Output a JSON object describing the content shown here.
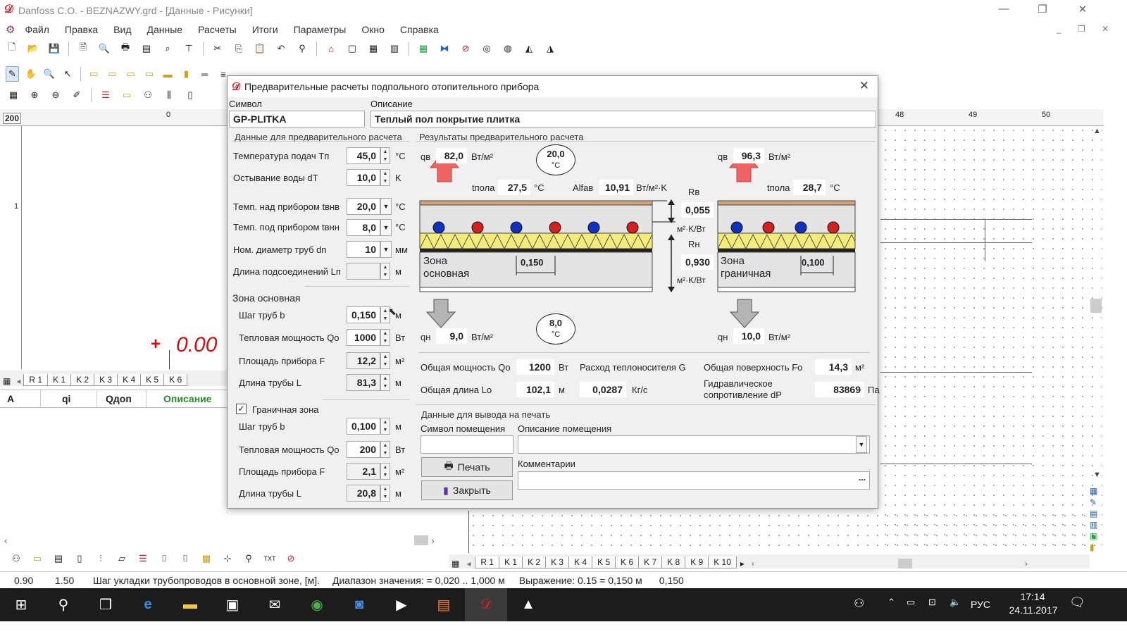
{
  "window": {
    "title": "Danfoss C.O.  - BEZNAZWY.grd - [Данные - Рисунки]"
  },
  "menu": [
    "Файл",
    "Правка",
    "Вид",
    "Данные",
    "Расчеты",
    "Итоги",
    "Параметры",
    "Окно",
    "Справка"
  ],
  "ruler": {
    "scale_label": "200",
    "zero": "0",
    "one": "1",
    "marks": [
      "48",
      "49",
      "50"
    ]
  },
  "left": {
    "elevation": "0.00",
    "plus": "+",
    "tabs": [
      "R 1",
      "K 1",
      "K 2",
      "K 3",
      "K 4",
      "K 5",
      "K 6"
    ],
    "table_headers": [
      "A",
      "qi",
      "Qдоп",
      "Описание"
    ]
  },
  "dialog": {
    "title": "Предварительные расчеты подпольного отопительного прибора",
    "symbol_label": "Символ",
    "symbol_value": "GP-PLITKA",
    "desc_label": "Описание",
    "desc_value": "Теплый пол покрытие плитка",
    "input_section": "Данные для предварительного расчета",
    "inputs": [
      {
        "label": "Температура подач  Tп",
        "value": "45,0",
        "unit": "°С",
        "ctl": "spin"
      },
      {
        "label": "Остывание воды dT",
        "value": "10,0",
        "unit": "K",
        "ctl": "spin"
      },
      {
        "label": "Темп. над прибором tвнв",
        "value": "20,0",
        "unit": "°С",
        "ctl": "dd"
      },
      {
        "label": "Темп. под прибором tвнн",
        "value": "8,0",
        "unit": "°С",
        "ctl": "dd"
      },
      {
        "label": "Ном. диаметр труб dn",
        "value": "10",
        "unit": "мм",
        "ctl": "dd"
      },
      {
        "label": "Длина подсоединений Lп",
        "value": "",
        "unit": "м",
        "ctl": "spin"
      }
    ],
    "zone_main": {
      "title": "Зона основная",
      "rows": [
        {
          "label": "Шаг труб b",
          "value": "0,150",
          "unit": "м"
        },
        {
          "label": "Тепловая мощность Qo",
          "value": "1000",
          "unit": "Вт"
        },
        {
          "label": "Площадь прибора F",
          "value": "12,2",
          "unit": "м²"
        },
        {
          "label": "Длина трубы L",
          "value": "81,3",
          "unit": "м"
        }
      ]
    },
    "zone_edge": {
      "title": "Граничная зона",
      "checked": true,
      "rows": [
        {
          "label": "Шаг труб b",
          "value": "0,100",
          "unit": "м"
        },
        {
          "label": "Тепловая мощность Qo",
          "value": "200",
          "unit": "Вт"
        },
        {
          "label": "Площадь прибора F",
          "value": "2,1",
          "unit": "м²"
        },
        {
          "label": "Длина трубы L",
          "value": "20,8",
          "unit": "м"
        }
      ]
    },
    "results_section": "Результаты предварительного расчета",
    "results": {
      "qv_label": "qв",
      "qv_main": "82,0",
      "qv_edge": "96,3",
      "q_unit": "Вт/м²",
      "tpola_label": "tпола",
      "tpola_main": "27,5",
      "tpola_edge": "28,7",
      "t_unit": "°С",
      "alfa_label": "Alfaв",
      "alfa_value": "10,91",
      "alfa_unit": "Вт/м²·K",
      "t_up": "20,0",
      "t_down": "8,0",
      "deg": "°С",
      "rv_label": "Rв",
      "rv_value": "0,055",
      "rn_label": "Rн",
      "rn_value": "0,930",
      "r_unit": "м²·K/Вт",
      "qn_label": "qн",
      "qn_main": "9,0",
      "qn_edge": "10,0",
      "zone_main_label": "Зона\nосновная",
      "zone_edge_label": "Зона\nграничная",
      "pitch_main": "0,150",
      "pitch_edge": "0,100"
    },
    "totals": {
      "qo_label": "Общая мощность Qo",
      "qo_value": "1200",
      "qo_unit": "Вт",
      "g_label": "Расход теплоносителя G",
      "g_value": "0,0287",
      "g_unit": "Кг/с",
      "fo_label": "Общая поверхность Fo",
      "fo_value": "14,3",
      "fo_unit": "м²",
      "lo_label": "Общая длина Lo",
      "lo_value": "102,1",
      "lo_unit": "м",
      "dp_label": "Гидравлическое\nсопротивление dP",
      "dp_value": "83869",
      "dp_unit": "Па"
    },
    "print": {
      "section": "Данные для вывода на печать",
      "room_symbol_label": "Символ помещения",
      "room_desc_label": "Описание помещения",
      "comments_label": "Комментарии",
      "print_btn": "Печать",
      "close_btn": "Закрыть",
      "ellipsis": "..."
    }
  },
  "bottom_tabs": [
    "R 1",
    "K 1",
    "K 2",
    "K 3",
    "K 4",
    "K 5",
    "K 6",
    "K 7",
    "K 8",
    "K 9",
    "K 10"
  ],
  "status": {
    "a": "0.90",
    "b": "1.50",
    "msg": "Шаг укладки трубопроводов в основной зоне, [м].",
    "range": "Диапазон значения: = 0,020 .. 1,000 м",
    "expr": "Выражение:  0.15 = 0,150 м",
    "val": "0,150"
  },
  "taskbar": {
    "lang": "РУС",
    "time": "17:14",
    "date": "24.11.2017"
  },
  "colors": {
    "red_pipe": "#d42020",
    "blue_pipe": "#1030c0",
    "arrow_up": "#f06464",
    "arrow_down": "#a8a8a8",
    "insulation": "#f4ec7a",
    "floor": "#d4a37a"
  }
}
